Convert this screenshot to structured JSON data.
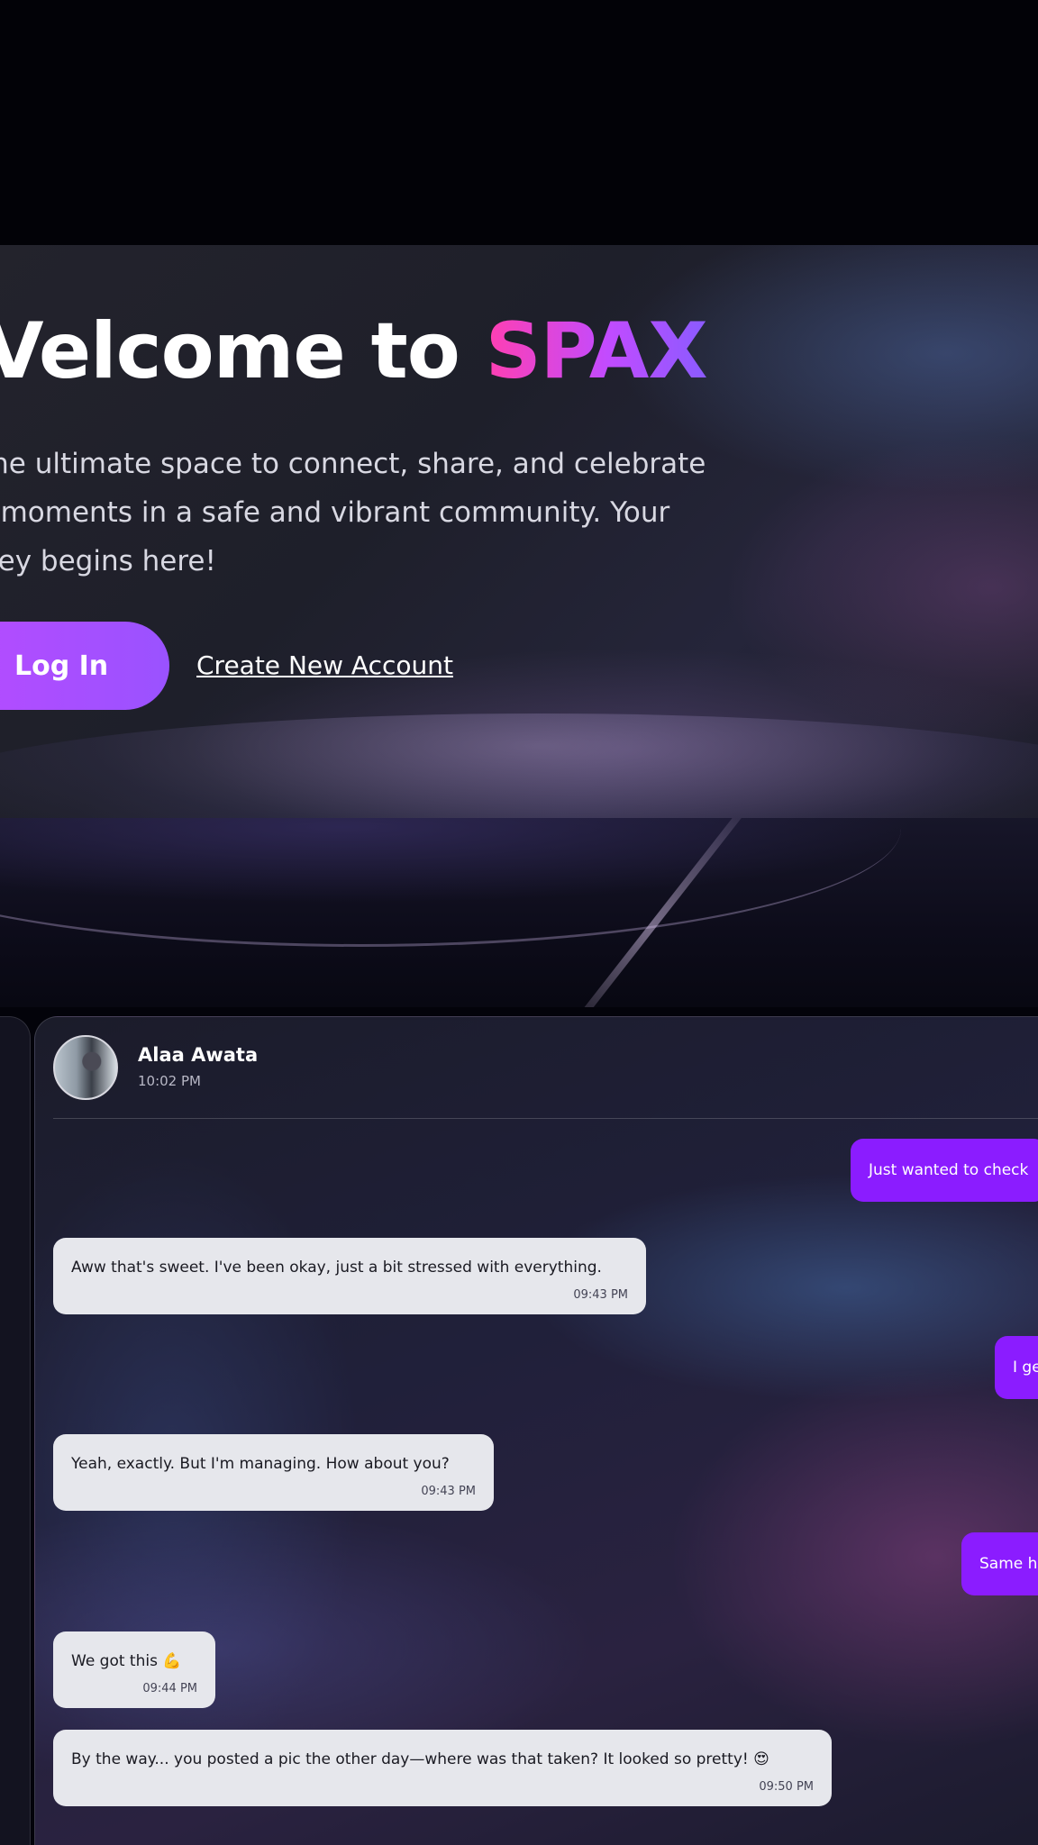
{
  "hero": {
    "title_prefix": "Velcome to ",
    "title_brand": "SPAX",
    "description": "the ultimate space to connect, share, and celebrate r moments in a safe and vibrant community. Your ney begins here!",
    "login_label": "Log In",
    "create_account_label": "Create New Account"
  },
  "chat": {
    "contact": {
      "name": "Alaa Awata",
      "status_time": "10:02 PM"
    },
    "messages": [
      {
        "direction": "out",
        "text": "Just wanted to check"
      },
      {
        "direction": "in",
        "text": "Aww that's sweet. I've been okay, just a bit stressed with everything.",
        "time": "09:43 PM"
      },
      {
        "direction": "out",
        "text": "I ge"
      },
      {
        "direction": "in",
        "text": "Yeah, exactly. But I'm managing. How about you?",
        "time": "09:43 PM"
      },
      {
        "direction": "out",
        "text": "Same h"
      },
      {
        "direction": "in",
        "text": "We got this 💪",
        "time": "09:44 PM"
      },
      {
        "direction": "in",
        "text": "By the way... you posted a pic the other day—where was that taken? It looked so pretty! 😍",
        "time": "09:50 PM"
      }
    ]
  },
  "colors": {
    "accent_purple": "#8b1cff",
    "brand_gradient_start": "#ff3fb1",
    "brand_gradient_end": "#8a5bff",
    "incoming_bubble": "#e6e7ec"
  },
  "icons": {
    "avatar": "contact-avatar-photo"
  }
}
